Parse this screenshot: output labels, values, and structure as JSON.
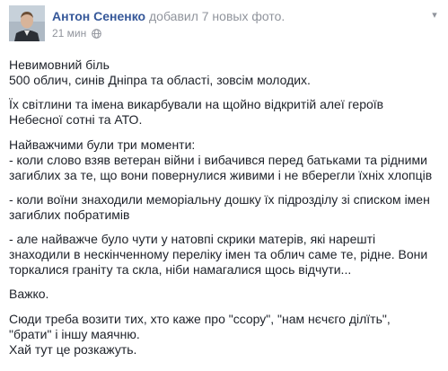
{
  "header": {
    "author": "Антон Сененко",
    "action": "добавил 7 новых фото.",
    "time": "21 мин",
    "privacy_icon": "globe-icon",
    "menu_icon": "chevron-down-icon"
  },
  "colors": {
    "author": "#365899",
    "meta": "#90949c",
    "text": "#1d2129"
  },
  "paragraphs": [
    {
      "lines": [
        "Невимовний біль",
        "500 облич, синів Дніпра та області, зовсім молодих."
      ]
    },
    {
      "lines": [
        "Їх світлини та імена викарбували на щойно відкритій алеї героїв",
        "Небесної сотні та АТО."
      ]
    },
    {
      "lines": [
        "Найважчими були три моменти:",
        "- коли слово взяв ветеран війни і вибачився перед батьками та рідними",
        "загиблих за те, що вони повернулися живими і не вберегли їхніх хлопців"
      ]
    },
    {
      "lines": [
        "- коли воїни знаходили меморіальну дошку їх підрозділу зі списком імен",
        "загиблих побратимів"
      ]
    },
    {
      "lines": [
        "- але найважче було чути у натовпі скрики матерів, які нарешті",
        "знаходили в нескінченному переліку імен та облич саме те, рідне. Вони",
        "торкалися граніту та скла, ніби намагалися щось відчути..."
      ]
    },
    {
      "lines": [
        "Важко."
      ]
    },
    {
      "lines": [
        "Сюди треба возити тих, хто каже про \"ссору\", \"нам нєчєго ділїть\",",
        "\"брати\" і іншу маячню.",
        "Хай тут це розкажуть."
      ]
    }
  ]
}
